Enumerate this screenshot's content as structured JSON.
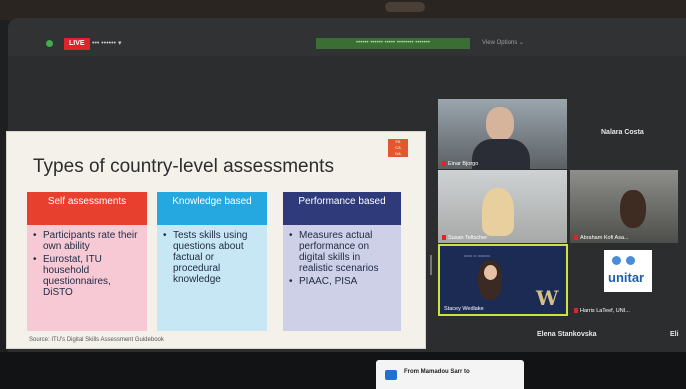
{
  "topbar": {
    "live_label": "LIVE",
    "meeting_label": "••• •••••• ▾",
    "speaking_banner": "•••••• •••••• ••••• •••••••• •••••••",
    "view_options": "View Options ⌄"
  },
  "slide": {
    "logo_lines": [
      "FA",
      "CA",
      "DA"
    ],
    "title": "Types of country-level assessments",
    "columns": [
      {
        "heading": "Self assessments",
        "bullets": [
          "Participants rate their own ability",
          "Eurostat, ITU household questionnaires, DiSTO"
        ]
      },
      {
        "heading": "Knowledge based",
        "bullets": [
          "Tests skills using questions about factual or procedural knowledge"
        ]
      },
      {
        "heading": "Performance based",
        "bullets": [
          "Measures actual performance on digital skills in realistic scenarios",
          "PIAAC, PISA"
        ]
      }
    ],
    "source": "Source: ITU's Digital Skills Assessment Guidebook"
  },
  "participants": {
    "einar": "Einar Bjorgo",
    "nalara": "Nalara Costa",
    "susan": "Susan Teltscher",
    "abraham": "Abraham Kofi Asa...",
    "stacey": "Stacey Wedlake",
    "harris": "Harris LaTeef, UNI...",
    "elena": "Elena Stankovska",
    "eli": "Eli"
  },
  "stacey_tile": {
    "logo_letter": "W",
    "top_text": "•••••• •• •••••••••"
  },
  "harris_tile": {
    "org": "unitar"
  },
  "chat": {
    "text": "From Mamadou Sarr to"
  }
}
